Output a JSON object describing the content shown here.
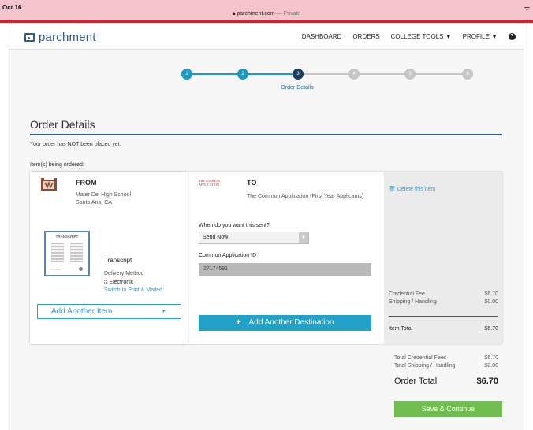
{
  "statusbar": {
    "date": "Oct 16",
    "url": "parchment.com",
    "private": "— Private"
  },
  "header": {
    "logo": "parchment",
    "nav": [
      "DASHBOARD",
      "ORDERS",
      "COLLEGE TOOLS ▼",
      "PROFILE ▼"
    ]
  },
  "stepper": {
    "steps": [
      "1",
      "2",
      "3",
      "4",
      "5",
      "6"
    ],
    "current": 3,
    "current_label": "Order Details"
  },
  "page": {
    "title": "Order Details",
    "notice": "Your order has NOT been placed yet.",
    "items_label": "Item(s) being ordered:"
  },
  "from": {
    "heading": "FROM",
    "school": "Mater Dei High School",
    "location": "Santa Ana, CA",
    "doc_thumb_title": "TRANSCRIPT",
    "item_name": "Transcript",
    "delivery_label": "Delivery Method",
    "delivery_value": "Electronic",
    "switch_link": "Switch to Print & Mailed",
    "add_item": "Add Another Item"
  },
  "to": {
    "logo_text": "THE COMMON APPLICATION",
    "heading": "TO",
    "recipient": "The Common Application (First Year Applicants)",
    "when_label": "When do you want this sent?",
    "when_value": "Send Now",
    "caid_label": "Common Application ID",
    "caid_value": "27174591",
    "add_destination": "Add Another Destination"
  },
  "fees": {
    "delete": "Delete this item",
    "credential_label": "Credential Fee",
    "credential_value": "$6.70",
    "shipping_label": "Shipping / Handling",
    "shipping_value": "$0.00",
    "item_total_label": "Item Total",
    "item_total_value": "$6.70"
  },
  "totals": {
    "cred_label": "Total Credential Fees",
    "cred_value": "$6.70",
    "ship_label": "Total Shipping / Handling",
    "ship_value": "$0.00",
    "order_total_label": "Order Total",
    "order_total_value": "$6.70",
    "save": "Save & Continue"
  },
  "colors": {
    "brand": "#2d5e8a",
    "accent": "#23a2c8",
    "step_done": "#1a9bbf",
    "step_current": "#1b3d5e",
    "step_todo": "#c6c6c6",
    "save": "#6fbe4f"
  }
}
